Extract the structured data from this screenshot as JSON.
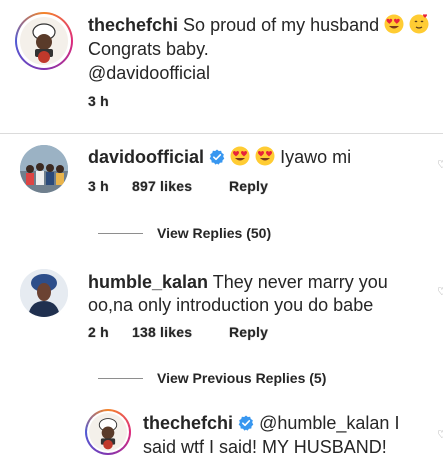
{
  "caption": {
    "username": "thechefchi",
    "text_line1": "So proud of my husband",
    "text_line2": "Congrats baby.",
    "mention": "@davidoofficial",
    "time": "3 h",
    "avatar_label": "CHEF CHI"
  },
  "comments": [
    {
      "username": "davidoofficial",
      "verified": true,
      "text": "Iyawo mi",
      "time": "3 h",
      "likes": "897 likes",
      "reply_label": "Reply",
      "view_replies": "View Replies (50)"
    },
    {
      "username": "humble_kalan",
      "verified": false,
      "text_line1": "They never marry you",
      "text_line2": "oo,na only introduction you do babe",
      "time": "2 h",
      "likes": "138 likes",
      "reply_label": "Reply",
      "view_replies": "View Previous Replies (5)"
    }
  ],
  "reply": {
    "username": "thechefchi",
    "verified": true,
    "mention": "@humble_kalan",
    "text_line1_tail": "I",
    "text_line2": "said wtf I said! MY HUSBAND!"
  },
  "colors": {
    "verified": "#3897f0",
    "text": "#262626",
    "muted": "#8e8e8e"
  },
  "icons": [
    "heart-eyes-emoji",
    "heart-face-emoji",
    "verified-badge-icon",
    "like-heart-icon"
  ]
}
